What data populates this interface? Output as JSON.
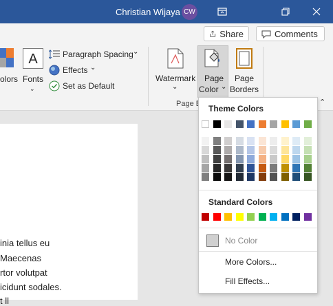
{
  "titlebar": {
    "user_name": "Christian Wijaya",
    "avatar_initials": "CW",
    "bg": "#2b579a"
  },
  "ribbon": {
    "share_label": "Share",
    "comments_label": "Comments",
    "colors_label": "olors",
    "fonts_label": "Fonts",
    "paragraph_spacing_label": "Paragraph Spacing",
    "effects_label": "Effects",
    "set_default_label": "Set as Default",
    "watermark_label": "Watermark",
    "page_color_label1": "Page",
    "page_color_label2": "Color",
    "page_borders_label1": "Page",
    "page_borders_label2": "Borders",
    "group_label": "Page B"
  },
  "document": {
    "lines": [
      "inia tellus eu",
      "Maecenas",
      "rtor volutpat",
      "icidunt sodales.",
      "     t     ll"
    ]
  },
  "page_color_menu": {
    "theme_heading": "Theme Colors",
    "standard_heading": "Standard Colors",
    "no_color": "No Color",
    "more_colors": "More Colors...",
    "fill_effects": "Fill Effects...",
    "theme_top_row": [
      "#ffffff",
      "#000000",
      "#e7e6e6",
      "#44546a",
      "#4472c4",
      "#ed7d31",
      "#a5a5a5",
      "#ffc000",
      "#5b9bd5",
      "#70ad47"
    ],
    "theme_shades": [
      [
        "#f2f2f2",
        "#7f7f7f",
        "#d0cece",
        "#d6dce4",
        "#d9e2f3",
        "#fbe5d5",
        "#ededed",
        "#fff2cc",
        "#deebf6",
        "#e2efd9"
      ],
      [
        "#d8d8d8",
        "#595959",
        "#aeabab",
        "#adb9ca",
        "#b4c6e7",
        "#f7cbac",
        "#dbdbdb",
        "#fee599",
        "#bdd7ee",
        "#c5e0b3"
      ],
      [
        "#bfbfbf",
        "#3f3f3f",
        "#757070",
        "#8496b0",
        "#8eaadb",
        "#f4b183",
        "#c9c9c9",
        "#ffd966",
        "#9cc3e5",
        "#a8d08d"
      ],
      [
        "#a5a5a5",
        "#262626",
        "#3a3838",
        "#323f4f",
        "#2f5496",
        "#c55a11",
        "#7b7b7b",
        "#bf9000",
        "#2e75b5",
        "#538135"
      ],
      [
        "#7f7f7f",
        "#0c0c0c",
        "#171616",
        "#222a35",
        "#1f3864",
        "#833c0b",
        "#525252",
        "#7f6000",
        "#1e4d78",
        "#375623"
      ]
    ],
    "standard_colors": [
      "#c00000",
      "#ff0000",
      "#ffc000",
      "#ffff00",
      "#92d050",
      "#00b050",
      "#00b0f0",
      "#0070c0",
      "#002060",
      "#7030a0"
    ]
  }
}
